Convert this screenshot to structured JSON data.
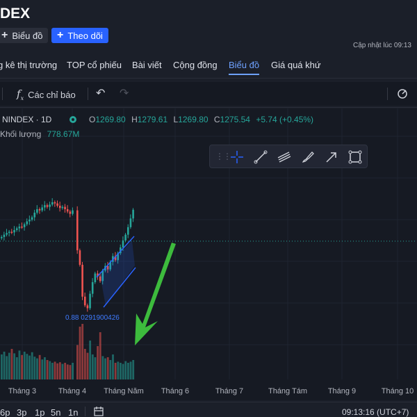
{
  "header": {
    "title": "DEX",
    "chart_button": "Biểu đồ",
    "follow_button": "Theo dõi",
    "updated_label": "Cập nhật lúc  09:13"
  },
  "nav": {
    "tabs": [
      "g kê thị trường",
      "TOP cổ phiếu",
      "Bài viết",
      "Cộng đồng",
      "Biểu đồ",
      "Giá quá khứ"
    ],
    "active": "Biểu đồ"
  },
  "toolbar": {
    "indicators_label": "Các chỉ báo"
  },
  "chart_legend": {
    "symbol": "NINDEX · 1D",
    "open_key": "O",
    "open": "1269.80",
    "high_key": "H",
    "high": "1279.61",
    "low_key": "L",
    "low": "1269.80",
    "close_key": "C",
    "close": "1275.54",
    "change": "+5.74 (+0.45%)",
    "volume_label": "Khối lượng",
    "volume_value": "778.67M",
    "annotation": "0.88 0291900426"
  },
  "drawing_tools": [
    "crosshair-icon",
    "trend-line-icon",
    "channel-icon",
    "brush-icon",
    "arrow-icon",
    "rectangle-icon"
  ],
  "xaxis": [
    "Tháng 3",
    "Tháng 4",
    "Tháng Năm",
    "Tháng 6",
    "Tháng 7",
    "Tháng Tám",
    "Tháng 9",
    "Tháng 10"
  ],
  "bottom": {
    "timeframes": [
      "6p",
      "3p",
      "1p",
      "5n",
      "1n"
    ],
    "clock": "09:13:16 (UTC+7)"
  },
  "colors": {
    "up": "#26a69a",
    "down": "#ef5350",
    "accent": "#2962ff",
    "arrow": "#3dbb3d"
  },
  "chart_data": {
    "type": "candlestick",
    "x_ticks": [
      "Tháng 3",
      "Tháng 4",
      "Tháng Năm",
      "Tháng 6",
      "Tháng 7",
      "Tháng Tám",
      "Tháng 9",
      "Tháng 10"
    ],
    "last": {
      "open": 1269.8,
      "high": 1279.61,
      "low": 1269.8,
      "close": 1275.54,
      "change": 5.74,
      "change_pct": 0.45
    },
    "volume_last_millions": 778.67,
    "approx_close_series": [
      1228,
      1232,
      1235,
      1237,
      1236,
      1240,
      1243,
      1246,
      1245,
      1250,
      1255,
      1258,
      1262,
      1270,
      1276,
      1274,
      1279,
      1283,
      1280,
      1284,
      1288,
      1286,
      1282,
      1278,
      1280,
      1276,
      1272,
      1268,
      1274,
      1205,
      1180,
      1125,
      1110,
      1105,
      1130,
      1150,
      1165,
      1160,
      1152,
      1170,
      1178,
      1172,
      1185,
      1195,
      1188,
      1200,
      1210,
      1222,
      1232,
      1245,
      1260,
      1275
    ],
    "volume_pattern": [
      0.45,
      0.5,
      0.42,
      0.48,
      0.55,
      0.47,
      0.4,
      0.52,
      0.44,
      0.5,
      0.46,
      0.43,
      0.49,
      0.41,
      0.38,
      0.44,
      0.36,
      0.4,
      0.35,
      0.33,
      0.3,
      0.32,
      0.29,
      0.31,
      0.28,
      0.3,
      0.27,
      0.26,
      0.3,
      0.62,
      0.95,
      1.0,
      0.55,
      0.48,
      0.7,
      0.45,
      0.4,
      0.6,
      0.85,
      0.42,
      0.38,
      0.4,
      0.35,
      0.45,
      0.3,
      0.32,
      0.3,
      0.28,
      0.33,
      0.3,
      0.32,
      0.35
    ]
  }
}
